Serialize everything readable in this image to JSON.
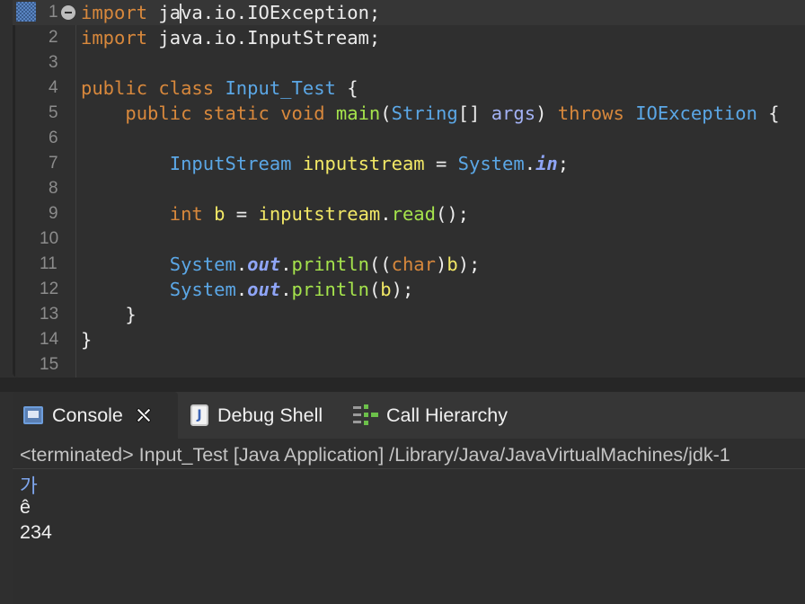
{
  "editor": {
    "lines": [
      {
        "num": "1",
        "tokens": [
          {
            "t": "import",
            "c": "kw"
          },
          {
            "t": " ja",
            "c": "plain"
          },
          {
            "t": "|",
            "c": "caret"
          },
          {
            "t": "va.io.",
            "c": "plain"
          },
          {
            "t": "IOException",
            "c": "plain"
          },
          {
            "t": ";",
            "c": "plain"
          }
        ]
      },
      {
        "num": "2",
        "tokens": [
          {
            "t": "import",
            "c": "kw"
          },
          {
            "t": " java.io.InputStream;",
            "c": "plain"
          }
        ]
      },
      {
        "num": "3",
        "tokens": []
      },
      {
        "num": "4",
        "tokens": [
          {
            "t": "public",
            "c": "kw"
          },
          {
            "t": " ",
            "c": "plain"
          },
          {
            "t": "class",
            "c": "kw"
          },
          {
            "t": " ",
            "c": "plain"
          },
          {
            "t": "Input_Test",
            "c": "cls"
          },
          {
            "t": " {",
            "c": "plain"
          }
        ]
      },
      {
        "num": "5",
        "tokens": [
          {
            "t": "    ",
            "c": "plain"
          },
          {
            "t": "public",
            "c": "kw"
          },
          {
            "t": " ",
            "c": "plain"
          },
          {
            "t": "static",
            "c": "kw"
          },
          {
            "t": " ",
            "c": "plain"
          },
          {
            "t": "void",
            "c": "kw"
          },
          {
            "t": " ",
            "c": "plain"
          },
          {
            "t": "main",
            "c": "method"
          },
          {
            "t": "(",
            "c": "plain"
          },
          {
            "t": "String",
            "c": "cls"
          },
          {
            "t": "[] ",
            "c": "plain"
          },
          {
            "t": "args",
            "c": "param"
          },
          {
            "t": ") ",
            "c": "plain"
          },
          {
            "t": "throws",
            "c": "kw"
          },
          {
            "t": " ",
            "c": "plain"
          },
          {
            "t": "IOException",
            "c": "cls"
          },
          {
            "t": " {",
            "c": "plain"
          }
        ]
      },
      {
        "num": "6",
        "tokens": []
      },
      {
        "num": "7",
        "tokens": [
          {
            "t": "        ",
            "c": "plain"
          },
          {
            "t": "InputStream",
            "c": "cls"
          },
          {
            "t": " ",
            "c": "plain"
          },
          {
            "t": "inputstream",
            "c": "var"
          },
          {
            "t": " = ",
            "c": "plain"
          },
          {
            "t": "System",
            "c": "cls"
          },
          {
            "t": ".",
            "c": "plain"
          },
          {
            "t": "in",
            "c": "fld"
          },
          {
            "t": ";",
            "c": "plain"
          }
        ]
      },
      {
        "num": "8",
        "tokens": []
      },
      {
        "num": "9",
        "tokens": [
          {
            "t": "        ",
            "c": "plain"
          },
          {
            "t": "int",
            "c": "kw"
          },
          {
            "t": " ",
            "c": "plain"
          },
          {
            "t": "b",
            "c": "var"
          },
          {
            "t": " = ",
            "c": "plain"
          },
          {
            "t": "inputstream",
            "c": "var"
          },
          {
            "t": ".",
            "c": "plain"
          },
          {
            "t": "read",
            "c": "method"
          },
          {
            "t": "();",
            "c": "plain"
          }
        ]
      },
      {
        "num": "10",
        "tokens": []
      },
      {
        "num": "11",
        "tokens": [
          {
            "t": "        ",
            "c": "plain"
          },
          {
            "t": "System",
            "c": "cls"
          },
          {
            "t": ".",
            "c": "plain"
          },
          {
            "t": "out",
            "c": "fld"
          },
          {
            "t": ".",
            "c": "plain"
          },
          {
            "t": "println",
            "c": "method"
          },
          {
            "t": "((",
            "c": "plain"
          },
          {
            "t": "char",
            "c": "kw"
          },
          {
            "t": ")",
            "c": "plain"
          },
          {
            "t": "b",
            "c": "var"
          },
          {
            "t": ");",
            "c": "plain"
          }
        ]
      },
      {
        "num": "12",
        "tokens": [
          {
            "t": "        ",
            "c": "plain"
          },
          {
            "t": "System",
            "c": "cls"
          },
          {
            "t": ".",
            "c": "plain"
          },
          {
            "t": "out",
            "c": "fld"
          },
          {
            "t": ".",
            "c": "plain"
          },
          {
            "t": "println",
            "c": "method"
          },
          {
            "t": "(",
            "c": "plain"
          },
          {
            "t": "b",
            "c": "var"
          },
          {
            "t": ");",
            "c": "plain"
          }
        ]
      },
      {
        "num": "13",
        "tokens": [
          {
            "t": "    }",
            "c": "plain"
          }
        ]
      },
      {
        "num": "14",
        "tokens": [
          {
            "t": "}",
            "c": "plain"
          }
        ]
      },
      {
        "num": "15",
        "tokens": []
      }
    ],
    "colors": {
      "keyword": "#d8883c",
      "type": "#5ba7e6",
      "variable": "#f2e866",
      "method": "#a5e34c",
      "field": "#8fa5f7",
      "plain": "#ececec",
      "background": "#2f2f2f"
    }
  },
  "tabs": {
    "console": {
      "label": "Console",
      "icon": "console-icon",
      "close_icon": "close-icon"
    },
    "debug_shell": {
      "label": "Debug Shell",
      "icon": "debug-shell-icon"
    },
    "call_hierarchy": {
      "label": "Call Hierarchy",
      "icon": "call-hierarchy-icon"
    }
  },
  "console": {
    "status": "<terminated> Input_Test [Java Application] /Library/Java/JavaVirtualMachines/jdk-1",
    "output": [
      "가",
      "ê",
      "234"
    ]
  }
}
